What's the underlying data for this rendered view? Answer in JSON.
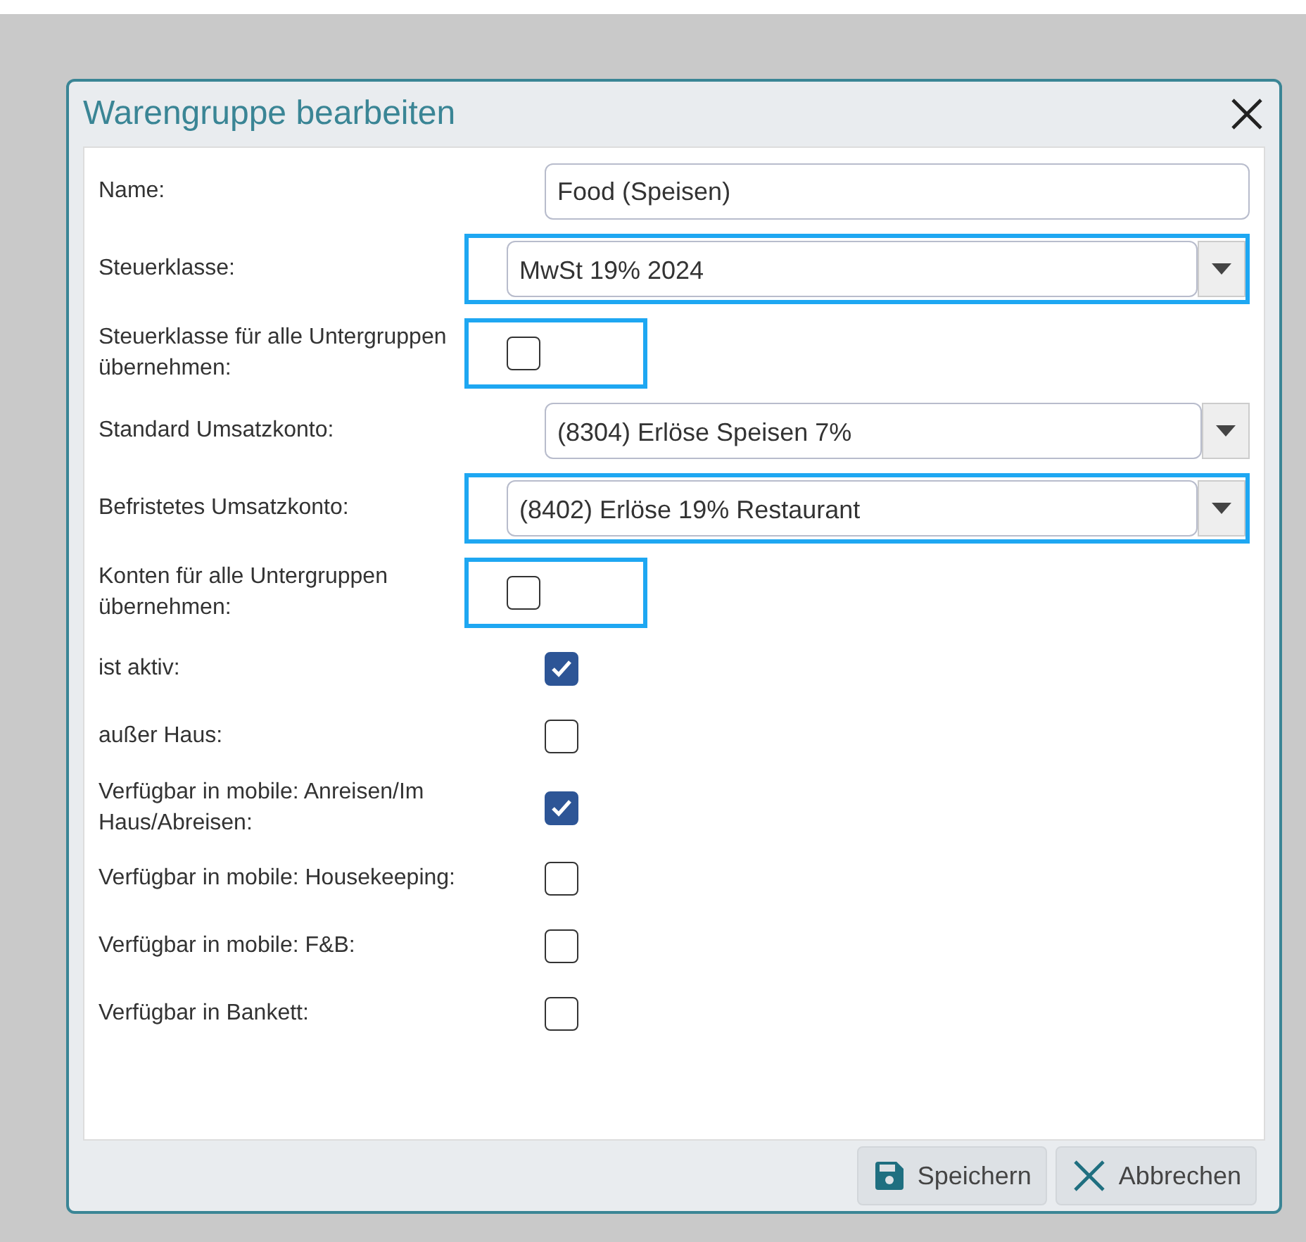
{
  "dialog": {
    "title": "Warengruppe bearbeiten",
    "fields": [
      {
        "kind": "text",
        "label": "Name:",
        "value": "Food (Speisen)"
      },
      {
        "kind": "select",
        "label": "Steuerklasse:",
        "value": "MwSt 19% 2024",
        "highlighted": true
      },
      {
        "kind": "checkbox",
        "label": "Steuerklasse für alle Untergruppen übernehmen:",
        "checked": false,
        "highlighted": true
      },
      {
        "kind": "select",
        "label": "Standard Umsatzkonto:",
        "value": "(8304) Erlöse Speisen 7%"
      },
      {
        "kind": "select",
        "label": "Befristetes Umsatzkonto:",
        "value": "(8402) Erlöse 19% Restaurant",
        "highlighted": true
      },
      {
        "kind": "checkbox",
        "label": "Konten für alle Untergruppen übernehmen:",
        "checked": false,
        "highlighted": true
      },
      {
        "kind": "checkbox",
        "label": "ist aktiv:",
        "checked": true
      },
      {
        "kind": "checkbox",
        "label": "außer Haus:",
        "checked": false
      },
      {
        "kind": "checkbox",
        "label": "Verfügbar in mobile: Anreisen/Im Haus/Abreisen:",
        "checked": true
      },
      {
        "kind": "checkbox",
        "label": "Verfügbar in mobile: Housekeeping:",
        "checked": false
      },
      {
        "kind": "checkbox",
        "label": "Verfügbar in mobile: F&B:",
        "checked": false
      },
      {
        "kind": "checkbox",
        "label": "Verfügbar in Bankett:",
        "checked": false
      }
    ],
    "buttons": [
      {
        "kind": "save",
        "label": "Speichern"
      },
      {
        "kind": "cancel",
        "label": "Abbrechen"
      }
    ]
  }
}
